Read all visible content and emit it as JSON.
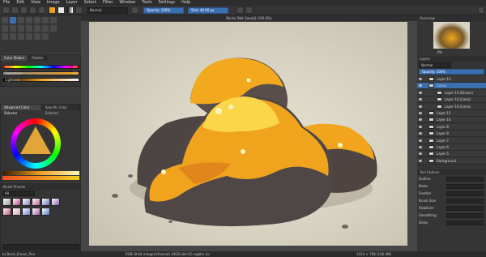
{
  "menu": [
    "File",
    "Edit",
    "View",
    "Image",
    "Layer",
    "Select",
    "Filter",
    "Window",
    "Tools",
    "Settings",
    "Help"
  ],
  "toolbar": {
    "blend_mode": "Normal",
    "opacity_label": "Opacity: 100%",
    "size_label": "Size: 40.00 px"
  },
  "document": {
    "tab_title": "Rocks [Not Saved] (100.0%)"
  },
  "color_panel": {
    "title": "Color Sliders",
    "tab2": "Palette",
    "hue_label": "Hue",
    "hue_value": "43",
    "sat_label": "Saturation",
    "sat_value": "82",
    "light_label": "Lightness",
    "light_value": "54"
  },
  "selector_tabs": [
    "Advanced Color Selector",
    "Specific Color Selector"
  ],
  "brush_panel": {
    "title": "Brush Presets",
    "tag": "All",
    "search_placeholder": "Search"
  },
  "overview": {
    "title": "Overview",
    "zoom": "9%"
  },
  "layers": {
    "title": "Layers",
    "mode": "Normal",
    "opacity": "Opacity: 100%",
    "items": [
      {
        "name": "Layer 12",
        "selected": false
      },
      {
        "name": "Curve",
        "selected": true
      },
      {
        "name": "Layer 10 (Drawn)",
        "selected": false
      },
      {
        "name": "Layer 10 (Lines)",
        "selected": false
      },
      {
        "name": "Layer 10 (Lines)",
        "selected": false
      },
      {
        "name": "Layer 15",
        "selected": false
      },
      {
        "name": "Layer 14",
        "selected": false
      },
      {
        "name": "Layer 8",
        "selected": false
      },
      {
        "name": "Layer 8",
        "selected": false
      },
      {
        "name": "Layer 7",
        "selected": false
      },
      {
        "name": "Layer 6",
        "selected": false
      },
      {
        "name": "Layer 5",
        "selected": false
      },
      {
        "name": "Background",
        "selected": false
      }
    ]
  },
  "tool_options": {
    "title": "Tool Options",
    "rows": [
      "Outline",
      "Mode",
      "Feather",
      "Brush Size",
      "Stabilizer",
      "Smoothing",
      "Delay"
    ]
  },
  "status": {
    "left": "b) Basic_Eraser_Pen",
    "middle": "RGB (8-bit integer/channel) sRGB-elle-V2-srgbtrc.icc",
    "right": "1024 × 768 (100.4M)"
  },
  "colors": {
    "accent": "#3a6fb0",
    "fg": "#f0a020",
    "bg": "#ffffff"
  }
}
